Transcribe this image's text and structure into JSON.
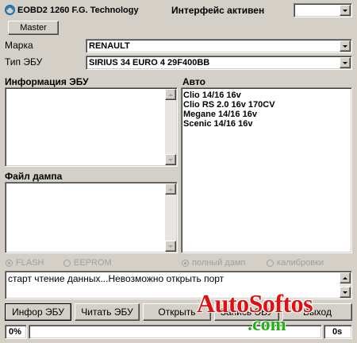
{
  "window": {
    "title": "EOBD2 1260 F.G. Technology",
    "status": "Интерфейс активен"
  },
  "interface_combo": {
    "value": ""
  },
  "master_button": "Master",
  "brand": {
    "label": "Марка",
    "value": "RENAULT"
  },
  "ecu_type": {
    "label": "Тип ЭБУ",
    "value": "SIRIUS 34 EURO 4 29F400BB"
  },
  "ecu_info": {
    "label": "Информация ЭБУ"
  },
  "dump_file": {
    "label": "Файл дампа"
  },
  "auto": {
    "label": "Авто",
    "items": [
      "Clio 14/16  16v",
      "Clio RS 2.0 16v 170CV",
      "Megane 14/16  16v",
      "Scenic 14/16  16v"
    ]
  },
  "memory_radios": {
    "flash": "FLASH",
    "eeprom": "EEPROM"
  },
  "dump_radios": {
    "full": "полный дамп",
    "calib": "калибровки"
  },
  "log": {
    "text": "старт чтение данных...Невозможно открыть порт"
  },
  "buttons": {
    "info": "Инфор ЭБУ",
    "read": "Читать ЭБУ",
    "open": "Открыть",
    "write": "Запись ЭБУ",
    "exit": "Выход"
  },
  "progress": {
    "percent_text": "0%",
    "value": 0,
    "time_text": "0s"
  },
  "watermark": {
    "line1": "AutoSoftos",
    "line2": ".com",
    "color": "#e01010",
    "domain_color": "#22b014"
  }
}
